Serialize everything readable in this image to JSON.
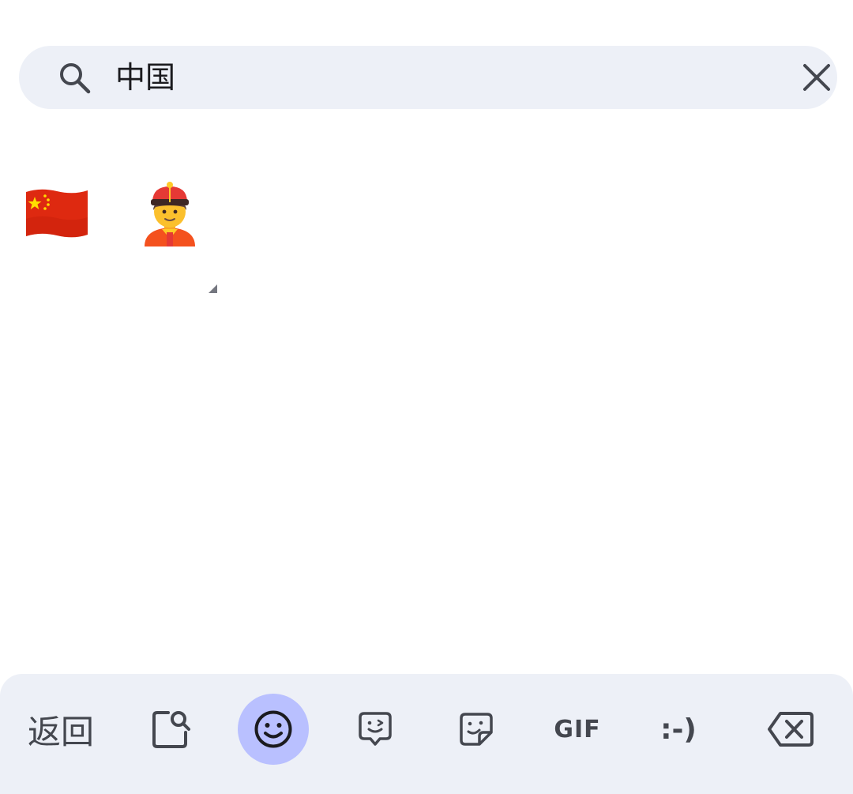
{
  "search": {
    "query": "中国"
  },
  "results": [
    {
      "emoji": "🇨🇳",
      "name": "flag-china",
      "has_variants": false
    },
    {
      "emoji": "👲",
      "name": "person-with-skullcap",
      "has_variants": true
    }
  ],
  "bottom_bar": {
    "back_label": "返回",
    "tabs": [
      {
        "id": "image-search",
        "icon": "image-search-icon",
        "active": false
      },
      {
        "id": "emoji",
        "icon": "smiley-icon",
        "active": true
      },
      {
        "id": "bitmoji",
        "icon": "bitmoji-icon",
        "active": false
      },
      {
        "id": "stickers",
        "icon": "sticker-icon",
        "active": false
      },
      {
        "id": "gif",
        "label": "GIF",
        "active": false
      },
      {
        "id": "emoticons",
        "label": ":-)",
        "active": false
      }
    ],
    "delete_icon": "backspace-icon"
  },
  "colors": {
    "background": "#ffffff",
    "surface": "#edf0f7",
    "active_tab": "#b9c0ff",
    "icon": "#44474f",
    "text": "#1b1b1f"
  }
}
